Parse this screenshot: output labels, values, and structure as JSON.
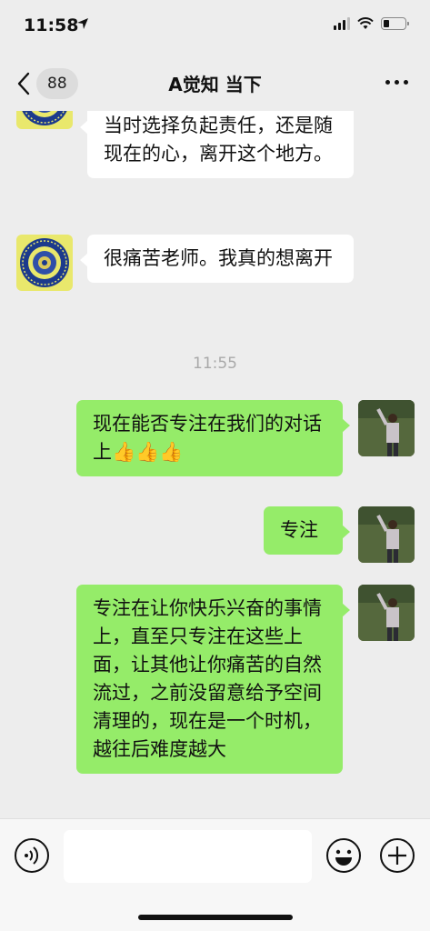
{
  "status_bar": {
    "time": "11:58",
    "battery_level": 0.25
  },
  "header": {
    "back_badge": "88",
    "title": "A觉知 当下"
  },
  "messages": [
    {
      "side": "left",
      "text": "当时选择负起责任，还是随现在的心，离开这个地方。"
    },
    {
      "side": "left",
      "text": "很痛苦老师。我真的想离开"
    },
    {
      "timestamp": "11:55"
    },
    {
      "side": "right",
      "text": "现在能否专注在我们的对话上👍👍👍"
    },
    {
      "side": "right",
      "text": "专注"
    },
    {
      "side": "right",
      "text": "专注在让你快乐兴奋的事情上，直至只专注在这些上面，让其他让你痛苦的自然流过，之前没留意给予空间清理的，现在是一个时机，越往后难度越大"
    }
  ],
  "input": {
    "placeholder": ""
  },
  "colors": {
    "background": "#ededed",
    "bubble_self": "#95ec69",
    "bubble_other": "#ffffff"
  },
  "icons": [
    "location-arrow-icon",
    "signal-icon",
    "wifi-icon",
    "battery-icon",
    "back-chevron-icon",
    "more-icon",
    "voice-icon",
    "emoji-icon",
    "plus-icon"
  ]
}
